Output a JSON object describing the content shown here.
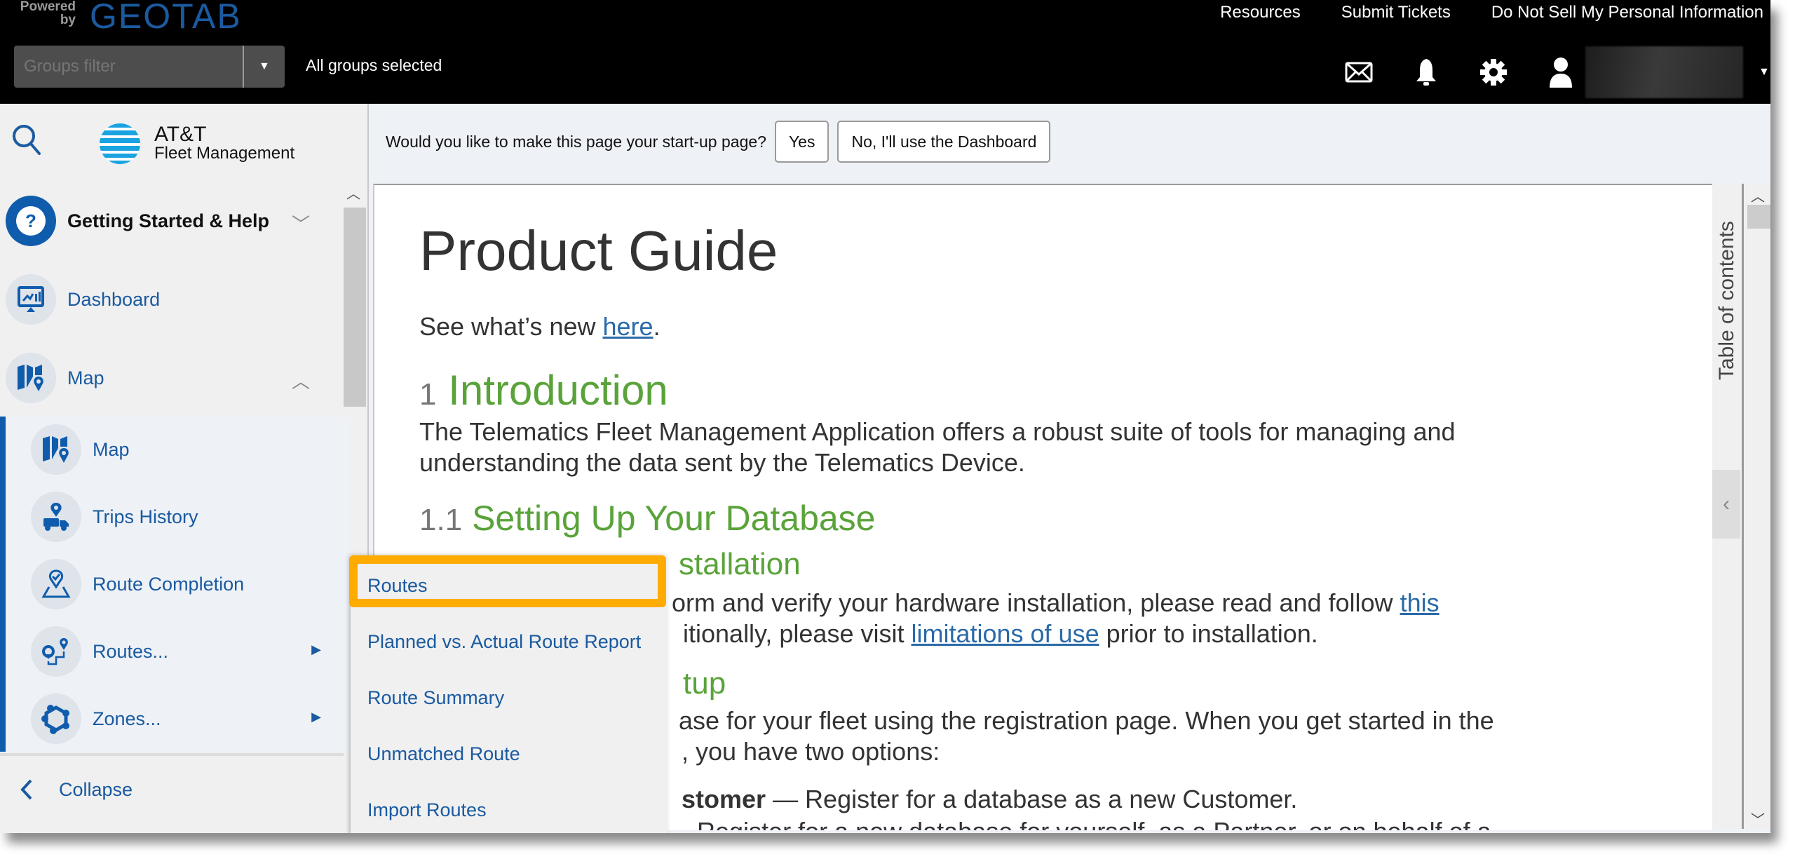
{
  "header": {
    "powered_by": "Powered by",
    "brand": "GEOTAB",
    "links": [
      "Resources",
      "Submit Tickets",
      "Do Not Sell My Personal Information"
    ],
    "groups_filter_placeholder": "Groups filter",
    "groups_status": "All groups selected",
    "icons": [
      "mail-icon",
      "bell-icon",
      "gear-icon",
      "user-icon"
    ]
  },
  "sidebar": {
    "logo_line1": "AT&T",
    "logo_line2": "Fleet Management",
    "items": [
      {
        "label": "Getting Started & Help",
        "icon": "help-icon",
        "chevron": "down"
      },
      {
        "label": "Dashboard",
        "icon": "dashboard-icon"
      },
      {
        "label": "Map",
        "icon": "map-icon",
        "chevron": "up"
      }
    ],
    "sub_items": [
      {
        "label": "Map",
        "icon": "map-icon"
      },
      {
        "label": "Trips History",
        "icon": "trips-icon"
      },
      {
        "label": "Route Completion",
        "icon": "route-completion-icon"
      },
      {
        "label": "Routes...",
        "icon": "routes-icon",
        "has_submenu": true
      },
      {
        "label": "Zones...",
        "icon": "zones-icon",
        "has_submenu": true
      }
    ],
    "collapse_label": "Collapse"
  },
  "startup": {
    "question": "Would you like to make this page your start-up page?",
    "yes": "Yes",
    "no": "No, I'll use the Dashboard"
  },
  "doc": {
    "title": "Product Guide",
    "whats_new_prefix": "See what’s new ",
    "whats_new_link": "here",
    "whats_new_suffix": ".",
    "intro_num": "1",
    "intro_title": "Introduction",
    "intro_line1": "The Telematics Fleet Management Application offers a robust suite of tools for managing and",
    "intro_line2": "understanding the data sent by the Telematics Device.",
    "s11_num": "1.1",
    "s11_title": "Setting Up Your Database",
    "hw_title_visible": "stallation",
    "hw_line1_prefix": "orm and verify your hardware installation, please read and follow ",
    "hw_line1_link": "this",
    "hw_line2_prefix": "itionally, please visit ",
    "hw_line2_link": "limitations of use",
    "hw_line2_suffix": " prior to installation.",
    "setup_title_visible": "tup",
    "setup_line1": "ase for your fleet using the registration page. When you get started in the",
    "setup_line2": ", you have two options:",
    "customer_bold": "stomer",
    "customer_rest": " — Register for a database as a new Customer.",
    "partner_partial": "Register for a new database for yourself, as a Partner, or on behalf of a"
  },
  "toc": {
    "label": "Table of contents"
  },
  "popup_menu": {
    "items": [
      "Routes",
      "Planned vs. Actual Route Report",
      "Route Summary",
      "Unmatched Route",
      "Import Routes"
    ],
    "highlighted": "Routes"
  },
  "colors": {
    "brand_blue": "#1a5aa0",
    "heading_green": "#5aa33a",
    "highlight_orange": "#ffab00"
  }
}
